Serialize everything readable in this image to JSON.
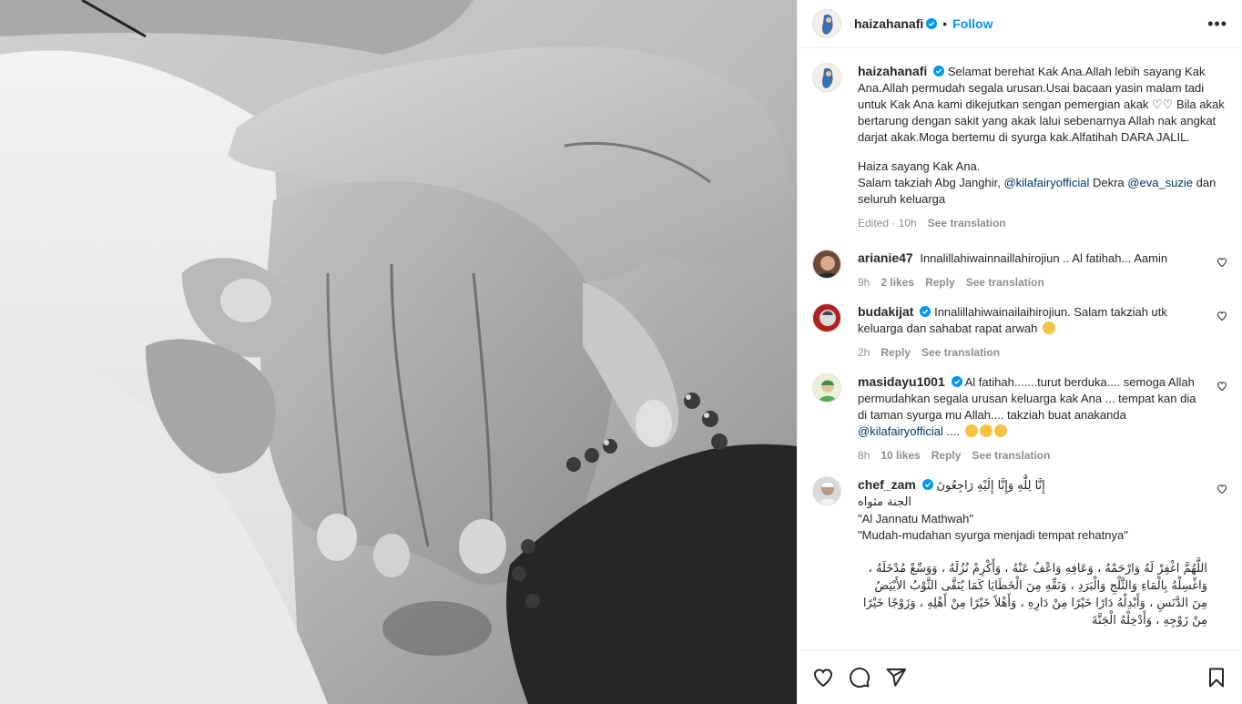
{
  "header": {
    "username": "haizahanafi",
    "separator": "•",
    "follow_label": "Follow",
    "more_icon": "more-horizontal-icon"
  },
  "caption": {
    "username": "haizahanafi",
    "text": "Selamat berehat Kak Ana.Allah lebih sayang Kak Ana.Allah permudah segala urusan.Usai bacaan yasin malam tadi untuk Kak Ana kami dikejutkan sengan pemergian akak ♡♡ Bila akak bertarung dengan sakit yang akak lalui sebenarnya Allah nak angkat darjat akak.Moga bertemu di syurga kak.Alfatihah DARA JALIL.",
    "line2": "Haiza sayang Kak Ana.",
    "line3_prefix": "Salam takziah Abg Janghir,",
    "mention1": "@kilafairyofficial",
    "line3_mid": "Dekra",
    "mention2": "@eva_suzie",
    "line3_suffix": "dan seluruh keluarga",
    "edited": "Edited · 10h",
    "see_translation": "See translation"
  },
  "comments": [
    {
      "username": "arianie47",
      "verified": false,
      "text": "Innalillahiwainnaillahirojiun .. Al fatihah... Aamin",
      "time": "9h",
      "likes": "2 likes",
      "reply": "Reply",
      "see_translation": "See translation"
    },
    {
      "username": "budakijat",
      "verified": true,
      "text": "Innalillahiwainailaihirojiun. Salam takziah utk keluarga dan sahabat rapat arwah",
      "time": "2h",
      "reply": "Reply",
      "see_translation": "See translation"
    },
    {
      "username": "masidayu1001",
      "verified": true,
      "text": "Al fatihah.......turut berduka.... semoga Allah permudahkan segala urusan keluarga kak Ana ... tempat kan dia di taman syurga mu Allah.... takziah buat anakanda",
      "mention": "@kilafairyofficial",
      "tail": "....",
      "time": "8h",
      "likes": "10 likes",
      "reply": "Reply",
      "see_translation": "See translation"
    },
    {
      "username": "chef_zam",
      "verified": true,
      "arabic1": "إِنَّا لِلَّٰهِ وَإِنَّا إِلَيْهِ رَاجِعُونَ",
      "arabic2": "الجنة مثواه",
      "line3": "\"Al Jannatu Mathwah\"",
      "line4": "\"Mudah-mudahan syurga menjadi tempat rehatnya\"",
      "arabic_dua": "اللَّهُمَّ اغْفِرْ لَهُ وَارْحَمْهُ ، وَعَافِهِ وَاعْفُ عَنْهُ ، وَأَكْرِمْ نُزُلَهُ ، وَوَسِّعْ مُدْخَلَهُ ، وَاغْسِلْهُ بِالْمَاءِ وَالثَّلْجِ وَالْبَرَدِ ، وَنَقِّهِ مِنَ الْخَطَايَا كَمَا يُنَقَّى الثَّوْبُ الأَبْيَضُ مِنَ الدَّنَسِ ، وَأَبْدِلْهُ دَارًا خَيْرًا مِنْ دَارِهِ ، وَأَهْلاً خَيْرًا مِنْ أَهْلِهِ ، وَزَوْجًا خَيْرًا مِنْ زَوْجِهِ ، وَأَدْخِلْهُ الْجَنَّةَ"
    }
  ],
  "actions": {
    "like_icon": "heart-icon",
    "comment_icon": "comment-icon",
    "share_icon": "share-icon",
    "save_icon": "bookmark-icon"
  },
  "colors": {
    "link": "#0095f6",
    "mention": "#00376b",
    "verified": "#0095f6",
    "muted": "#8e8e8e"
  }
}
